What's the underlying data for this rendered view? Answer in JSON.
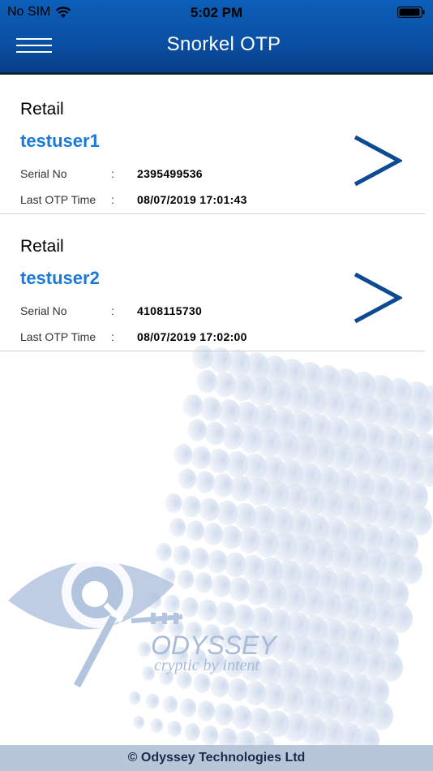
{
  "status_bar": {
    "carrier": "No SIM",
    "time": "5:02 PM"
  },
  "header": {
    "title": "Snorkel OTP"
  },
  "entries": [
    {
      "type": "Retail",
      "user": "testuser1",
      "serial_label": "Serial No",
      "serial": "2395499536",
      "time_label": "Last OTP Time",
      "last_otp_time": "08/07/2019 17:01:43",
      "colon": ":"
    },
    {
      "type": "Retail",
      "user": "testuser2",
      "serial_label": "Serial No",
      "serial": "4108115730",
      "time_label": "Last OTP Time",
      "last_otp_time": "08/07/2019 17:02:00",
      "colon": ":"
    }
  ],
  "logo": {
    "name": "ODYSSEY",
    "tagline": "cryptic by intent"
  },
  "footer": {
    "copyright": "© Odyssey Technologies Ltd"
  },
  "colors": {
    "header": "#0a4fa3",
    "user_link": "#1a7ad8",
    "chevron": "#0d4a92",
    "footer": "#b7c6d9"
  }
}
